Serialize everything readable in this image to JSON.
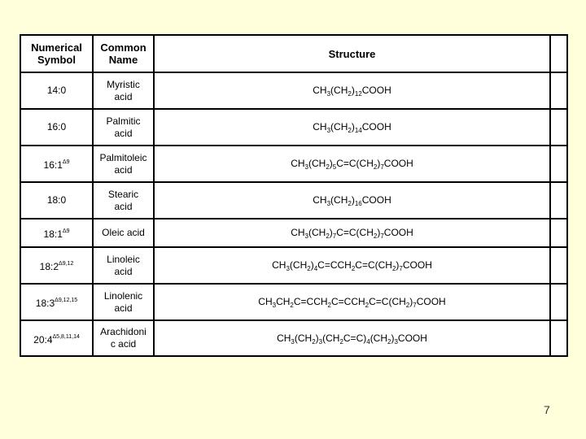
{
  "table": {
    "headers": [
      "Numerical\nSymbol",
      "Common\nName",
      "Structure",
      ""
    ],
    "header_lines": [
      [
        "Numerical",
        "Symbol"
      ],
      [
        "Common",
        "Name"
      ],
      [
        "Structure"
      ],
      [
        ""
      ]
    ],
    "rows": [
      {
        "symbol": "14:0",
        "delta": "",
        "name": [
          "Myristic",
          "acid"
        ],
        "structure": [
          [
            "CH"
          ],
          [
            "3",
            "sub"
          ],
          [
            "(CH"
          ],
          [
            "2",
            "sub"
          ],
          [
            ")"
          ],
          [
            "12",
            "sub"
          ],
          [
            "COOH"
          ]
        ]
      },
      {
        "symbol": "16:0",
        "delta": "",
        "name": [
          "Palmitic",
          "acid"
        ],
        "structure": [
          [
            "CH"
          ],
          [
            "3",
            "sub"
          ],
          [
            "(CH"
          ],
          [
            "2",
            "sub"
          ],
          [
            ")"
          ],
          [
            "14",
            "sub"
          ],
          [
            "COOH"
          ]
        ]
      },
      {
        "symbol": "16:1",
        "delta": "Δ9",
        "name": [
          "Palmitoleic",
          "acid"
        ],
        "structure": [
          [
            "CH"
          ],
          [
            "3",
            "sub"
          ],
          [
            "(CH"
          ],
          [
            "2",
            "sub"
          ],
          [
            ")"
          ],
          [
            "5",
            "sub"
          ],
          [
            "C=C(CH"
          ],
          [
            "2",
            "sub"
          ],
          [
            ")"
          ],
          [
            "7",
            "sub"
          ],
          [
            "COOH"
          ]
        ]
      },
      {
        "symbol": "18:0",
        "delta": "",
        "name": [
          "Stearic",
          "acid"
        ],
        "structure": [
          [
            "CH"
          ],
          [
            "3",
            "sub"
          ],
          [
            "(CH"
          ],
          [
            "2",
            "sub"
          ],
          [
            ")"
          ],
          [
            "16",
            "sub"
          ],
          [
            "COOH"
          ]
        ]
      },
      {
        "symbol": "18:1",
        "delta": "Δ9",
        "name": [
          "Oleic acid"
        ],
        "structure": [
          [
            "CH"
          ],
          [
            "3",
            "sub"
          ],
          [
            "(CH"
          ],
          [
            "2",
            "sub"
          ],
          [
            ")"
          ],
          [
            "7",
            "sub"
          ],
          [
            "C=C(CH"
          ],
          [
            "2",
            "sub"
          ],
          [
            ")"
          ],
          [
            "7",
            "sub"
          ],
          [
            "COOH"
          ]
        ]
      },
      {
        "symbol": "18:2",
        "delta": "Δ9,12",
        "name": [
          "Linoleic",
          "acid"
        ],
        "structure": [
          [
            "CH"
          ],
          [
            "3",
            "sub"
          ],
          [
            "(CH"
          ],
          [
            "2",
            "sub"
          ],
          [
            ")"
          ],
          [
            "4",
            "sub"
          ],
          [
            "C=CCH"
          ],
          [
            "2",
            "sub"
          ],
          [
            "C=C(CH"
          ],
          [
            "2",
            "sub"
          ],
          [
            ")"
          ],
          [
            "7",
            "sub"
          ],
          [
            "COOH"
          ]
        ]
      },
      {
        "symbol": "18:3",
        "delta": "Δ9,12,15",
        "name": [
          "Linolenic",
          "acid"
        ],
        "structure": [
          [
            "CH"
          ],
          [
            "3",
            "sub"
          ],
          [
            "CH"
          ],
          [
            "2",
            "sub"
          ],
          [
            "C=CCH"
          ],
          [
            "2",
            "sub"
          ],
          [
            "C=CCH"
          ],
          [
            "2",
            "sub"
          ],
          [
            "C=C(CH"
          ],
          [
            "2",
            "sub"
          ],
          [
            ")"
          ],
          [
            "7",
            "sub"
          ],
          [
            "COOH"
          ]
        ]
      },
      {
        "symbol": "20:4",
        "delta": "Δ5,8,11,14",
        "name": [
          "Arachidoni",
          "c acid"
        ],
        "structure": [
          [
            "CH"
          ],
          [
            "3",
            "sub"
          ],
          [
            "(CH"
          ],
          [
            "2",
            "sub"
          ],
          [
            ")"
          ],
          [
            "3",
            "sub"
          ],
          [
            "(CH"
          ],
          [
            "2",
            "sub"
          ],
          [
            "C=C)"
          ],
          [
            "4",
            "sub"
          ],
          [
            "(CH"
          ],
          [
            "2",
            "sub"
          ],
          [
            ")"
          ],
          [
            "3",
            "sub"
          ],
          [
            "COOH"
          ]
        ]
      }
    ]
  },
  "page_number": "7"
}
